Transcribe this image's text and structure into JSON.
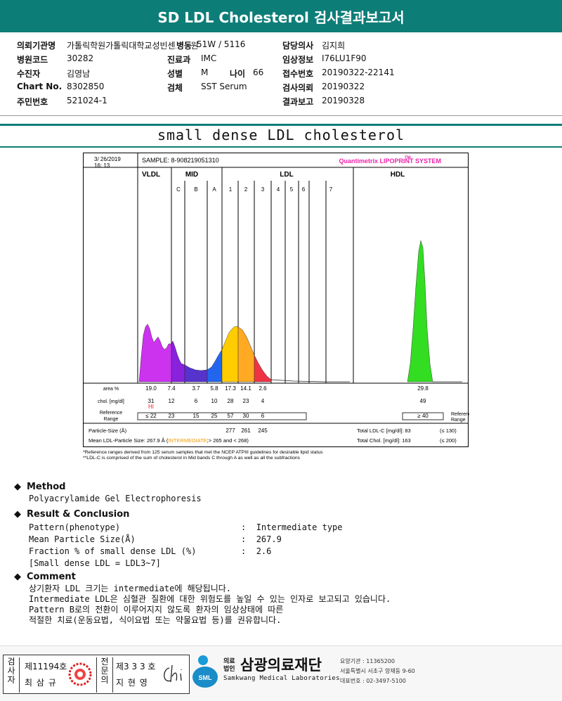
{
  "report": {
    "title": "SD LDL Cholesterol 검사결과보고서",
    "subtitle": "small dense LDL cholesterol"
  },
  "patient": {
    "fields": [
      {
        "label": "의뢰기관명",
        "value": "가톨릭학원가톨릭대학교성빈센트병원"
      },
      {
        "label": "병동",
        "value": "51W / 5116"
      },
      {
        "label": "담당의사",
        "value": "김지희"
      },
      {
        "label": "병원코드",
        "value": "30282"
      },
      {
        "label": "진료과",
        "value": "IMC"
      },
      {
        "label": "임상정보",
        "value": "I76LU1F90"
      },
      {
        "label": "수진자",
        "value": "김영남"
      },
      {
        "label": "성별",
        "value": "M"
      },
      {
        "label": "나이",
        "value": "66"
      },
      {
        "label": "접수번호",
        "value": "20190322-22141"
      },
      {
        "label": "Chart No.",
        "value": "8302850"
      },
      {
        "label": "검체",
        "value": "SST Serum"
      },
      {
        "label": "검사의뢰",
        "value": "20190322"
      },
      {
        "label": "주민번호",
        "value": "521024-1"
      },
      {
        "label": "결과보고",
        "value": "20190328"
      }
    ]
  },
  "chart_data": {
    "type": "area",
    "title": "Quantimetrix LIPOPRINT SYSTEM",
    "trademark": "TM",
    "date": "3/ 26/2019",
    "time": "16: 13",
    "sample": "SAMPLE:   8-908219051310",
    "groups": [
      "VLDL",
      "MID",
      "LDL",
      "HDL"
    ],
    "bands": [
      "C",
      "B",
      "A",
      "1",
      "2",
      "3",
      "4",
      "5",
      "6",
      "7"
    ],
    "rows": [
      {
        "label": "area %",
        "values": [
          "19.0",
          "7.4",
          "3.7",
          "5.8",
          "17.3",
          "14.1",
          "2.6",
          "",
          "",
          "",
          "",
          "29.8"
        ]
      },
      {
        "label": "chol. [mg/dl]",
        "values": [
          "31",
          "12",
          "6",
          "10",
          "28",
          "23",
          "4",
          "",
          "",
          "",
          "",
          "49"
        ]
      },
      {
        "label": "Reference Range",
        "values": [
          "≤ 22",
          "23",
          "15",
          "25",
          "57",
          "30",
          "6",
          "",
          "",
          "",
          "",
          "≥ 40"
        ]
      }
    ],
    "hi_flag": "HI",
    "particle_size_label": "Particle-Size (Å)",
    "particle_sizes": [
      "277",
      "261",
      "245"
    ],
    "mean_size": {
      "label": "Mean LDL-Particle Size:",
      "value": "267.9 Å",
      "category": "INTERMEDIATE",
      "range": ";> 265 and < 268)"
    },
    "totals": [
      {
        "label": "Total LDL-C [mg/dl]:",
        "value": "83",
        "ref": "(≤ 130)"
      },
      {
        "label": "Total Chol. [mg/dl]:",
        "value": "163",
        "ref": "(≤ 200)"
      }
    ],
    "ref_header": "Reference Range",
    "footnotes": [
      "*Reference ranges derived from 125 serum samples that met the NCEP ATPIII guidelines for desirable lipid status",
      "**LDL-C is comprised of the sum of cholesterol in Mid bands C through A as well as all the subfractions"
    ],
    "colors": {
      "vldl": "#cc33ee",
      "midC": "#8822dd",
      "midB": "#5533cc",
      "midA": "#2266ee",
      "ldl1": "#ffcc00",
      "ldl2": "#ffaa22",
      "ldl3": "#ee3344",
      "hdl": "#33dd22",
      "title": "#ee22aa",
      "hi": "#ee2222",
      "intermediate": "#ee9900"
    }
  },
  "method": {
    "head": "Method",
    "text": "Polyacrylamide Gel Electrophoresis"
  },
  "result": {
    "head": "Result & Conclusion",
    "items": [
      {
        "label": "Pattern(phenotype)",
        "value": "Intermediate type"
      },
      {
        "label": "Mean Particle Size(Å)",
        "value": "267.9"
      },
      {
        "label": "Fraction % of small dense LDL (%)",
        "value": "2.6"
      }
    ],
    "note": "[Small dense LDL = LDL3~7]"
  },
  "comment": {
    "head": "Comment",
    "lines": [
      "상기환자 LDL 크기는 intermediate에 해당됩니다.",
      "Intermediate LDL은 심혈관 질환에 대한 위험도를 높일 수 있는 인자로 보고되고 있습니다.",
      "Pattern B로의 전환이 이루어지지 않도록 환자의 임상상태에 따른",
      "적절한 치료(운동요법, 식이요법 또는 약물요법 등)를 권유합니다."
    ]
  },
  "footer": {
    "signers": [
      {
        "role": "검사자",
        "no": "제11194호",
        "name": "최 삼 규"
      },
      {
        "role": "전문의",
        "no": "제3 3 3 호",
        "name": "지 현 영"
      }
    ],
    "org_prefix": "의료법인",
    "org_name": "삼광의료재단",
    "org_en": "Samkwang Medical Laboratories",
    "logo_text": "SML",
    "info": [
      "요양기관 : 11365200",
      "서울특별시 서초구 양재동 9-60",
      "대표번호 : 02-3497-5100"
    ]
  }
}
